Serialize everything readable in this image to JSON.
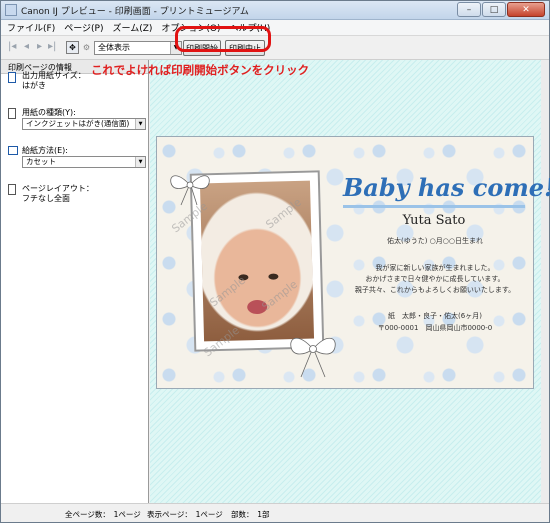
{
  "window": {
    "title": "Canon IJ プレビュー - 印刷画面 - プリントミュージアム",
    "buttons": [
      "–",
      "□",
      "✕"
    ]
  },
  "menu": [
    "ファイル(F)",
    "ページ(P)",
    "ズーム(Z)",
    "オプション(O)",
    "ヘルプ(H)"
  ],
  "toolbar": {
    "zoom_value": "全体表示",
    "print_start": "印刷開始",
    "print_cancel": "印刷中止"
  },
  "annotation": "これでよければ印刷開始ボタンをクリック",
  "accent_color": "#e11212",
  "left_panel": {
    "header": "印刷ページの情報",
    "output_size_label": "出力用紙サイズ：",
    "output_size_value": "はがき",
    "paper_type_label": "用紙の種類(Y):",
    "paper_type_value": "インクジェットはがき(通信面)",
    "feed_label": "給紙方法(E):",
    "feed_value": "カセット",
    "layout_label": "ページレイアウト：",
    "layout_value": "フチなし全面"
  },
  "card": {
    "heading": "Baby has come!",
    "name": "Yuta Sato",
    "birth": "佑太(ゆうた) ○月○○日生まれ",
    "line1": "我が家に新しい家族が生まれました。",
    "line2": "おかげさまで日々健やかに成長しています。",
    "line3": "親子共々、これからもよろしくお願いいたします。",
    "family": "紙　太郎・良子・佑太(6ヶ月)",
    "address": "〒000-0001　岡山県岡山市0000-0",
    "watermark": "Sample"
  },
  "status": {
    "total_pages": "全ページ数：　1ページ",
    "shown_page": "表示ページ：　1ページ",
    "copies": "部数：　1部"
  }
}
